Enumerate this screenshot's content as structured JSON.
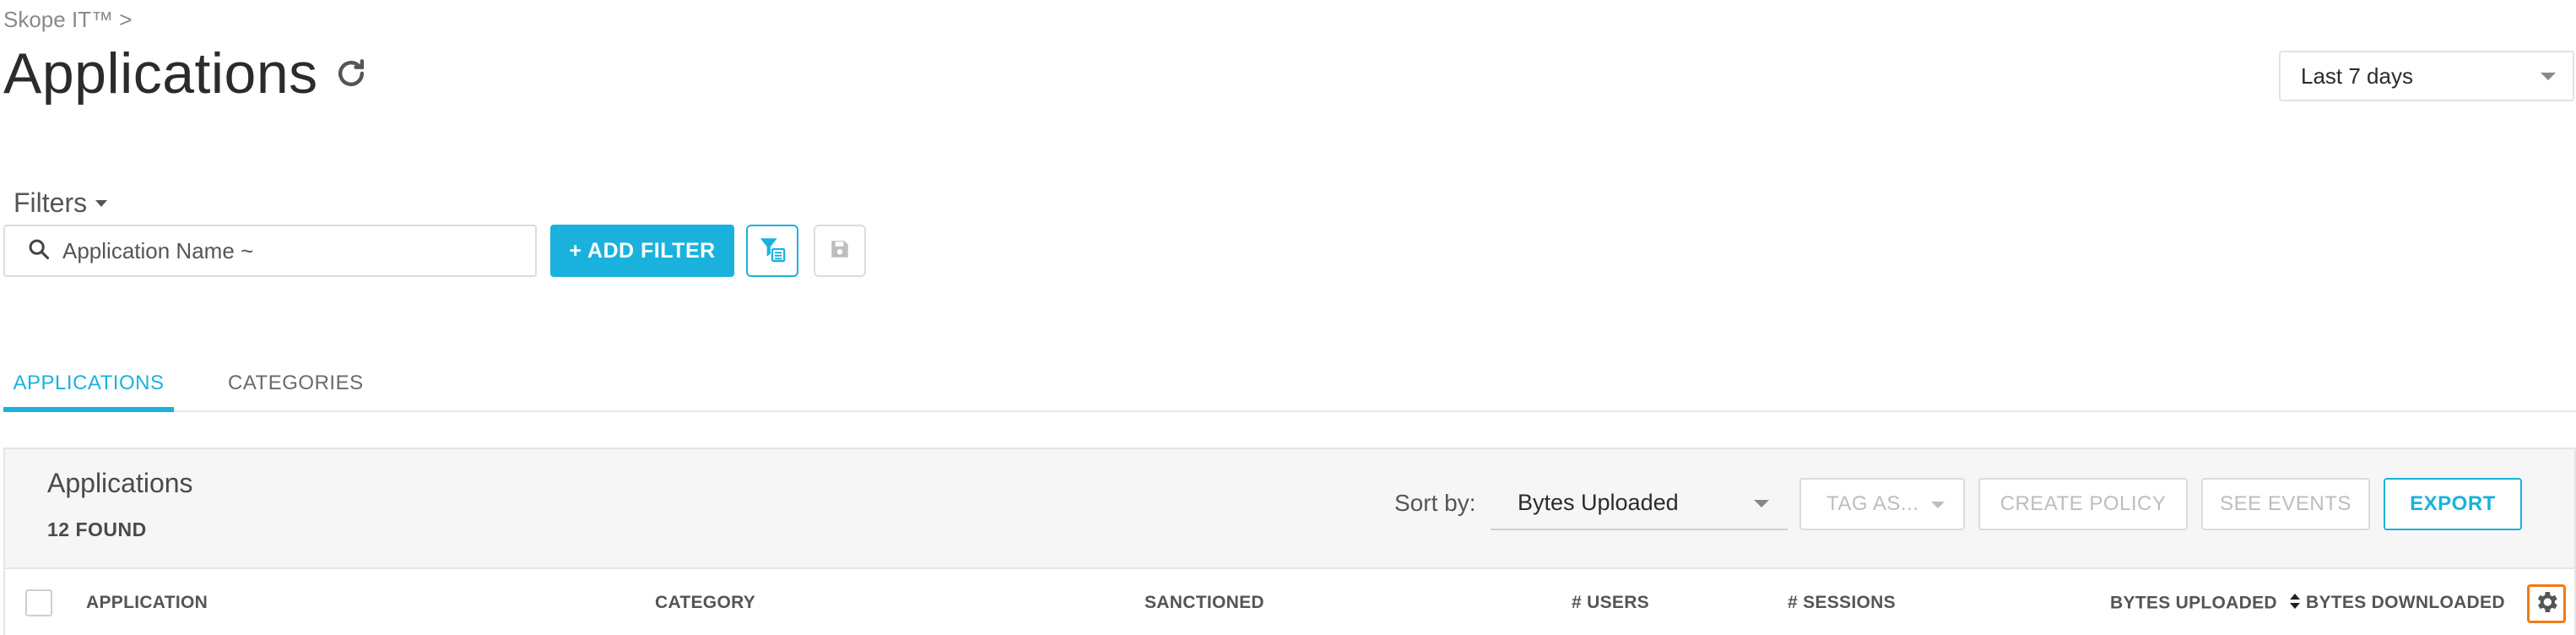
{
  "breadcrumb": {
    "text": "Skope IT™ >"
  },
  "header": {
    "title": "Applications"
  },
  "date_range": {
    "value": "Last 7 days"
  },
  "filters": {
    "label": "Filters",
    "search_placeholder": "Application Name ~",
    "add_filter_label": "+ ADD FILTER"
  },
  "tabs": [
    {
      "label": "APPLICATIONS",
      "active": true
    },
    {
      "label": "CATEGORIES",
      "active": false
    }
  ],
  "panel": {
    "title": "Applications",
    "count": "12 FOUND",
    "sort_label": "Sort by:",
    "sort_value": "Bytes Uploaded",
    "tag_label": "TAG AS...",
    "create_policy_label": "CREATE POLICY",
    "see_events_label": "SEE EVENTS",
    "export_label": "EXPORT"
  },
  "table": {
    "columns": [
      "APPLICATION",
      "CATEGORY",
      "SANCTIONED",
      "# USERS",
      "# SESSIONS",
      "BYTES UPLOADED",
      "BYTES DOWNLOADED"
    ],
    "sorted_column": "BYTES UPLOADED"
  },
  "colors": {
    "accent": "#1ab2dd",
    "settings_highlight": "#f07a16"
  },
  "icons": [
    "refresh-icon",
    "search-icon",
    "filter-list-icon",
    "save-icon",
    "sort-icon",
    "gear-icon"
  ]
}
